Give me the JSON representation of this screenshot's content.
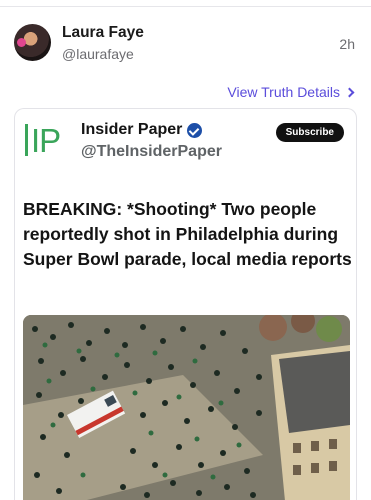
{
  "post": {
    "author_name": "Laura Faye",
    "author_handle": "@laurafaye",
    "time": "2h",
    "details_link": "View Truth Details"
  },
  "embed": {
    "source_logo": "IP",
    "source_name": "Insider Paper",
    "source_handle": "@TheInsiderPaper",
    "subscribe_label": "Subscribe",
    "headline": "BREAKING: *Shooting* Two people reportedly shot in Philadelphia during Super Bowl parade, local media reports"
  },
  "colors": {
    "link": "#5b4ddb",
    "logo_green": "#3aa55a",
    "verified_blue": "#1d4fa8"
  },
  "icons": {
    "details": "chevron-right-icon",
    "verified": "verified-badge-icon"
  }
}
